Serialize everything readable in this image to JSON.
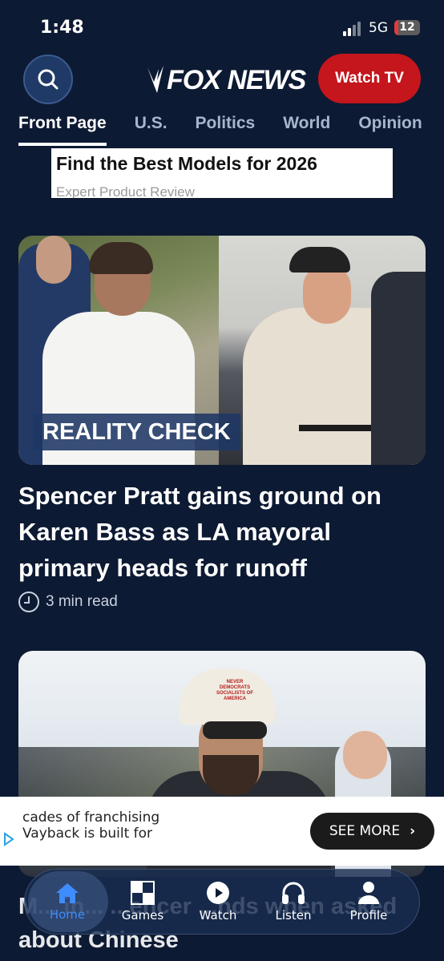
{
  "status_bar": {
    "time": "1:48",
    "network": "5G",
    "battery": "12"
  },
  "header": {
    "logo_text": "FOX NEWS",
    "watch_tv_label": "Watch TV"
  },
  "tabs": [
    {
      "label": "Front Page",
      "active": true
    },
    {
      "label": "U.S."
    },
    {
      "label": "Politics"
    },
    {
      "label": "World"
    },
    {
      "label": "Opinion"
    }
  ],
  "ad_top": {
    "headline": "Find the Best Models for 2026",
    "source": "Expert Product Review"
  },
  "article1": {
    "badge": "REALITY CHECK",
    "headline": "Spencer Pratt gains ground on Karen Bass as LA mayoral primary heads for runoff",
    "read_time": "3 min read"
  },
  "article2": {
    "cap_text": "NEVER DEMOCRATS SOCIALISTS OF AMERICA",
    "headline_fragment": "M... in... ...encer ...nds when asked about Chinese"
  },
  "ad_bottom": {
    "line1": "cades of franchising",
    "line2": "Vayback is built for",
    "button": "SEE MORE"
  },
  "bottom_nav": [
    {
      "label": "Home",
      "icon": "home-icon",
      "active": true
    },
    {
      "label": "Games",
      "icon": "games-icon"
    },
    {
      "label": "Watch",
      "icon": "play-icon"
    },
    {
      "label": "Listen",
      "icon": "headphones-icon"
    },
    {
      "label": "Profile",
      "icon": "profile-icon"
    }
  ],
  "colors": {
    "background": "#0d1a33",
    "accent_red": "#c4161c",
    "active_blue": "#3f8cff"
  }
}
